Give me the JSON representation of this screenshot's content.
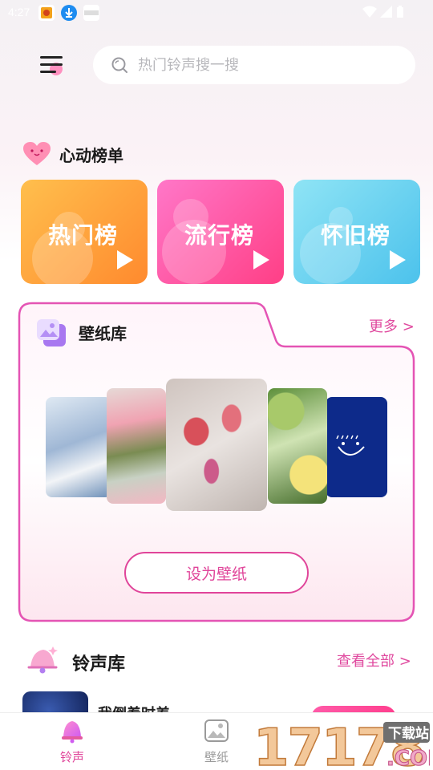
{
  "status_bar": {
    "time": "4:27"
  },
  "search": {
    "placeholder": "热门铃声搜一搜"
  },
  "chart_section": {
    "title": "心动榜单",
    "cards": [
      {
        "label": "热门榜",
        "color_from": "#ffbf4d",
        "color_to": "#ff8a2e"
      },
      {
        "label": "流行榜",
        "color_from": "#ff77c8",
        "color_to": "#ff3f86"
      },
      {
        "label": "怀旧榜",
        "color_from": "#8fe4f5",
        "color_to": "#4cc2ec"
      }
    ]
  },
  "wallpaper_section": {
    "title": "壁纸库",
    "more_label": "更多 >",
    "set_button_label": "设为壁纸"
  },
  "ringtone_section": {
    "title": "铃声库",
    "view_all_label": "查看全部 >",
    "first_song": "我倒着时差"
  },
  "tabbar": {
    "tabs": [
      {
        "label": "铃声",
        "active": true
      },
      {
        "label": "壁纸",
        "active": false
      }
    ]
  },
  "watermark": {
    "text": "17178",
    "badge": "下载站",
    "suffix": ".COM"
  },
  "colors": {
    "accent": "#e0459a",
    "active_tab": "#e0459a",
    "inactive_tab": "#9a9a9a"
  }
}
